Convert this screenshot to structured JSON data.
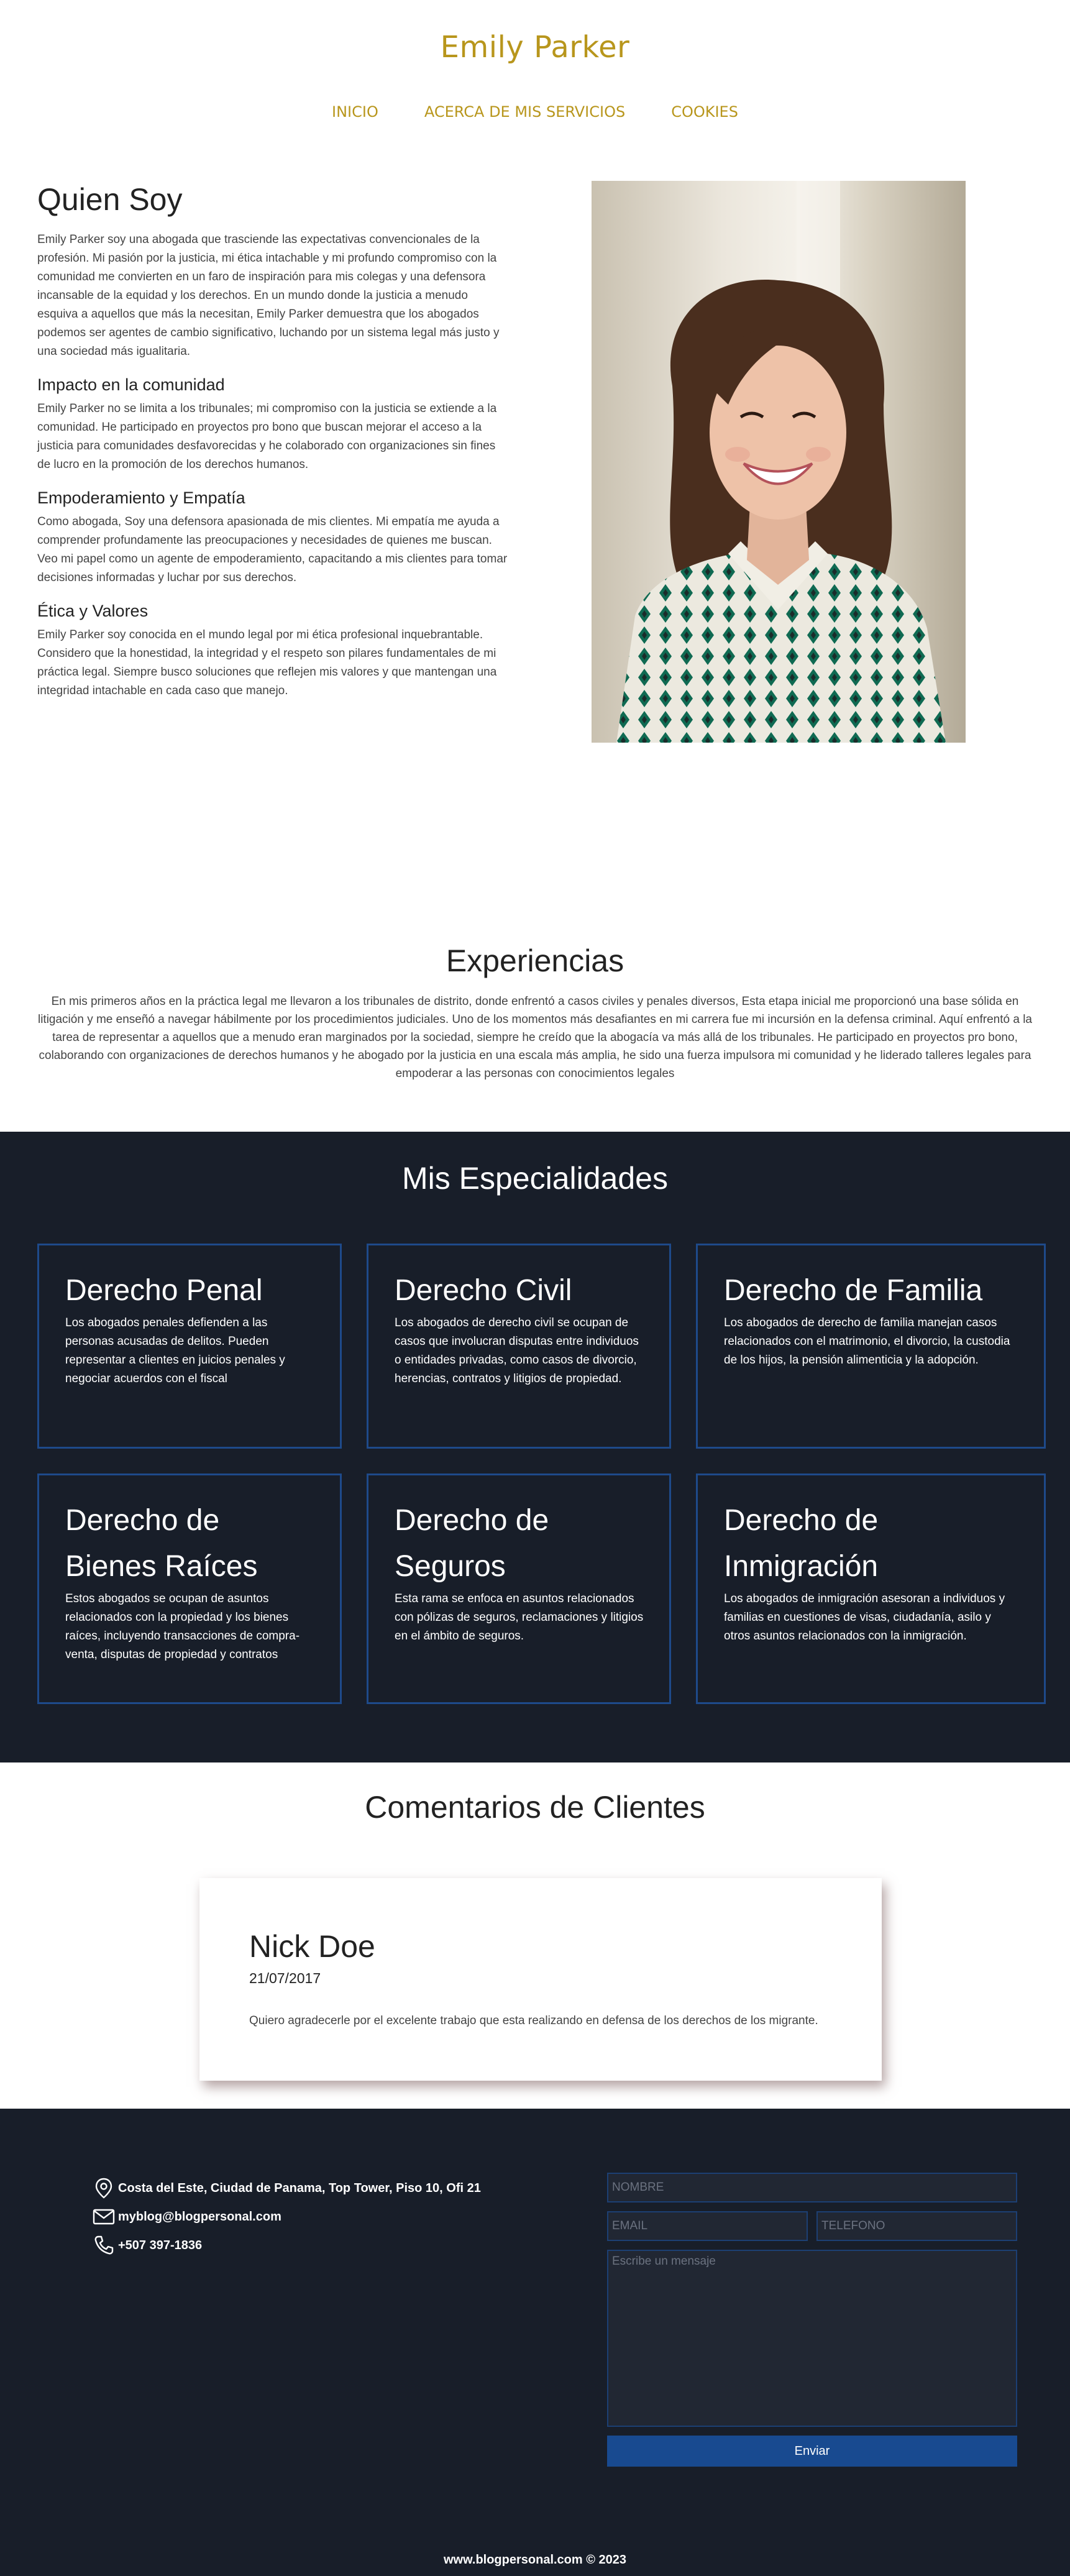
{
  "header": {
    "brand": "Emily Parker",
    "nav": [
      "INICIO",
      "ACERCA DE MIS SERVICIOS",
      "COOKIES"
    ]
  },
  "about": {
    "title": "Quien Soy",
    "intro": "Emily Parker soy una abogada que trasciende las expectativas convencionales de la profesión. Mi pasión por la justicia, mi ética intachable y mi profundo compromiso con la comunidad me convierten en un faro de inspiración para mis colegas y una defensora incansable de la equidad y los derechos. En un mundo donde la justicia a menudo esquiva a aquellos que más la necesitan, Emily Parker demuestra que los abogados podemos ser agentes de cambio significativo, luchando por un sistema legal más justo y una sociedad más igualitaria.",
    "sections": [
      {
        "heading": "Impacto en la comunidad",
        "text": "Emily Parker no se limita a los tribunales; mi compromiso con la justicia se extiende a la comunidad. He participado en proyectos pro bono que buscan mejorar el acceso a la justicia para comunidades desfavorecidas y he colaborado con organizaciones sin fines de lucro en la promoción de los derechos humanos."
      },
      {
        "heading": "Empoderamiento y Empatía",
        "text": "Como abogada, Soy una defensora apasionada de mis clientes. Mi empatía me ayuda a comprender profundamente las preocupaciones y necesidades de quienes me buscan. Veo mi papel como un agente de empoderamiento, capacitando a mis clientes para tomar decisiones informadas y luchar por sus derechos."
      },
      {
        "heading": "Ética y Valores",
        "text": "Emily Parker soy conocida en el mundo legal por mi ética profesional inquebrantable. Considero que la honestidad, la integridad y el respeto son pilares fundamentales de mi práctica legal. Siempre busco soluciones que reflejen mis valores y que mantengan una integridad intachable en cada caso que manejo."
      }
    ]
  },
  "experience": {
    "title": "Experiencias",
    "text": "En mis primeros años en la práctica legal me llevaron a los tribunales de distrito, donde enfrentó a casos civiles y penales diversos, Esta etapa inicial me proporcionó una base sólida en litigación y me enseñó a navegar hábilmente por los procedimientos judiciales. Uno de los momentos más desafiantes en mi carrera fue mi incursión en la defensa criminal. Aquí enfrentó a la tarea de representar a aquellos que a menudo eran marginados por la sociedad, siempre he creído que la abogacía va más allá de los tribunales. He participado en proyectos pro bono, colaborando con organizaciones de derechos humanos y he abogado por la justicia en una escala más amplia, he sido una fuerza impulsora mi comunidad y he liderado talleres legales para empoderar a las personas con conocimientos legales"
  },
  "specialties": {
    "title": "Mis Especialidades",
    "cards": [
      {
        "title": "Derecho Penal",
        "text": "Los abogados penales defienden a las personas acusadas de delitos. Pueden representar a clientes en juicios penales y negociar acuerdos con el fiscal"
      },
      {
        "title": "Derecho Civil",
        "text": "Los abogados de derecho civil se ocupan de casos que involucran disputas entre individuos o entidades privadas, como casos de divorcio, herencias, contratos y litigios de propiedad."
      },
      {
        "title": "Derecho de Familia",
        "text": "Los abogados de derecho de familia manejan casos relacionados con el matrimonio, el divorcio, la custodia de los hijos, la pensión alimenticia y la adopción."
      },
      {
        "title": "Derecho de Bienes Raíces",
        "text": "Estos abogados se ocupan de asuntos relacionados con la propiedad y los bienes raíces, incluyendo transacciones de compra-venta, disputas de propiedad y contratos"
      },
      {
        "title": "Derecho de Seguros",
        "text": "Esta rama se enfoca en asuntos relacionados con pólizas de seguros, reclamaciones y litigios en el ámbito de seguros."
      },
      {
        "title": "Derecho de Inmigración",
        "text": "Los abogados de inmigración asesoran a individuos y familias en cuestiones de visas, ciudadanía, asilo y otros asuntos relacionados con la inmigración."
      }
    ]
  },
  "comments": {
    "title": "Comentarios de Clientes",
    "items": [
      {
        "name": "Nick Doe",
        "date": "21/07/2017",
        "text": "Quiero agradecerle por el excelente trabajo que esta realizando en defensa de los derechos de los migrante."
      }
    ]
  },
  "footer": {
    "address": "Costa del Este, Ciudad de Panama, Top Tower, Piso 10, Ofi 21",
    "email": "myblog@blogpersonal.com",
    "phone": "+507 397-1836",
    "form": {
      "name_placeholder": "NOMBRE",
      "email_placeholder": "EMAIL",
      "phone_placeholder": "TELEFONO",
      "message_placeholder": "Escribe un mensaje",
      "submit_label": "Enviar"
    },
    "copyright": "www.blogpersonal.com © 2023"
  },
  "icons": {
    "location": "location-pin-icon",
    "email": "envelope-icon",
    "phone": "phone-icon"
  },
  "colors": {
    "accent_gold": "#b8961c",
    "dark_bg": "#181e29",
    "card_border": "#1e4a8a",
    "button_blue": "#184a90"
  }
}
